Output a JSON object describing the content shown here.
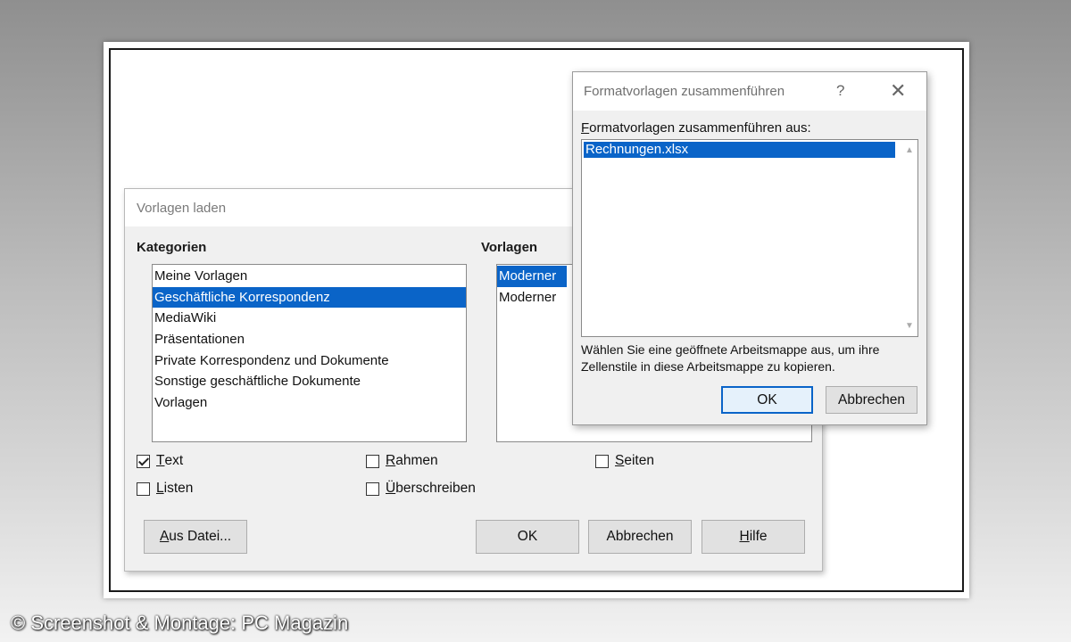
{
  "dialog_vorlagen": {
    "title": "Vorlagen laden",
    "kategorien_label": "Kategorien",
    "vorlagen_label": "Vorlagen",
    "kategorien": [
      "Meine Vorlagen",
      "Geschäftliche Korrespondenz",
      "MediaWiki",
      "Präsentationen",
      "Private Korrespondenz und Dokumente",
      "Sonstige geschäftliche Dokumente",
      "Vorlagen"
    ],
    "selected_kategorie": "Geschäftliche Korrespondenz",
    "vorlagen": [
      "Moderner",
      "Moderner"
    ],
    "checkboxes": {
      "text": {
        "label_u": "T",
        "label_rest": "ext",
        "checked": true
      },
      "rahmen": {
        "label_u": "R",
        "label_rest": "ahmen",
        "checked": false
      },
      "seiten": {
        "label_u": "S",
        "label_rest": "eiten",
        "checked": false
      },
      "listen": {
        "label_u": "L",
        "label_rest": "isten",
        "checked": false
      },
      "ueberschreiben": {
        "label_u": "Ü",
        "label_rest": "berschreiben",
        "checked": false
      }
    },
    "buttons": {
      "aus_datei_u": "A",
      "aus_datei_rest": "us Datei...",
      "ok": "OK",
      "abbrechen": "Abbrechen",
      "hilfe_u": "H",
      "hilfe_rest": "ilfe"
    }
  },
  "dialog_merge": {
    "title": "Formatvorlagen zusammenführen",
    "help_symbol": "?",
    "close_symbol": "✕",
    "list_label_u": "F",
    "list_label_rest": "ormatvorlagen zusammenführen aus:",
    "items": [
      "Rechnungen.xlsx"
    ],
    "hint": "Wählen Sie eine geöffnete Arbeitsmappe aus, um ihre Zellenstile in diese Arbeitsmappe zu kopieren.",
    "ok": "OK",
    "abbrechen": "Abbrechen"
  },
  "watermark": "© Screenshot & Montage: PC Magazin",
  "colors": {
    "selection": "#0a64c8",
    "dialog_bg": "#f0f0f0"
  },
  "icons": {
    "scroll_up": "▲",
    "scroll_down": "▼"
  }
}
